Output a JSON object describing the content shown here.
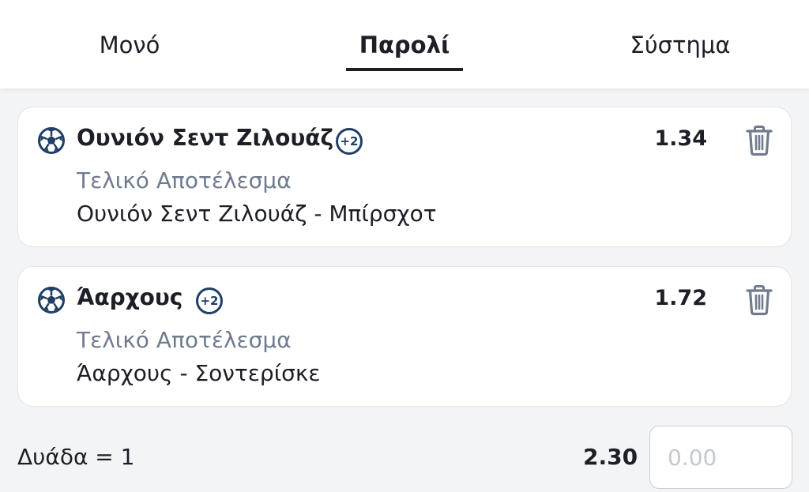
{
  "tabs": [
    {
      "label": "Μονό",
      "active": false
    },
    {
      "label": "Παρολί",
      "active": true
    },
    {
      "label": "Σύστημα",
      "active": false
    }
  ],
  "bets": [
    {
      "icon": "soccer-ball-icon",
      "team": "Ουνιόν Σεντ Ζιλουάζ",
      "extra": "+2",
      "odds": "1.34",
      "market": "Τελικό Αποτέλεσμα",
      "selection": "Ουνιόν Σεντ Ζιλουάζ - Μπίρσχοτ"
    },
    {
      "icon": "soccer-ball-icon",
      "team": "Άαρχους",
      "extra": "+2",
      "odds": "1.72",
      "market": "Τελικό Αποτέλεσμα",
      "selection": "Άαρχους - Σοντερίσκε"
    }
  ],
  "footer": {
    "combo_label": "Δυάδα = 1",
    "combo_odds": "2.30",
    "stake_placeholder": "0.00"
  },
  "colors": {
    "accent": "#1f3f66",
    "muted_text": "#6f7b8e",
    "background": "#f3f4f6"
  }
}
